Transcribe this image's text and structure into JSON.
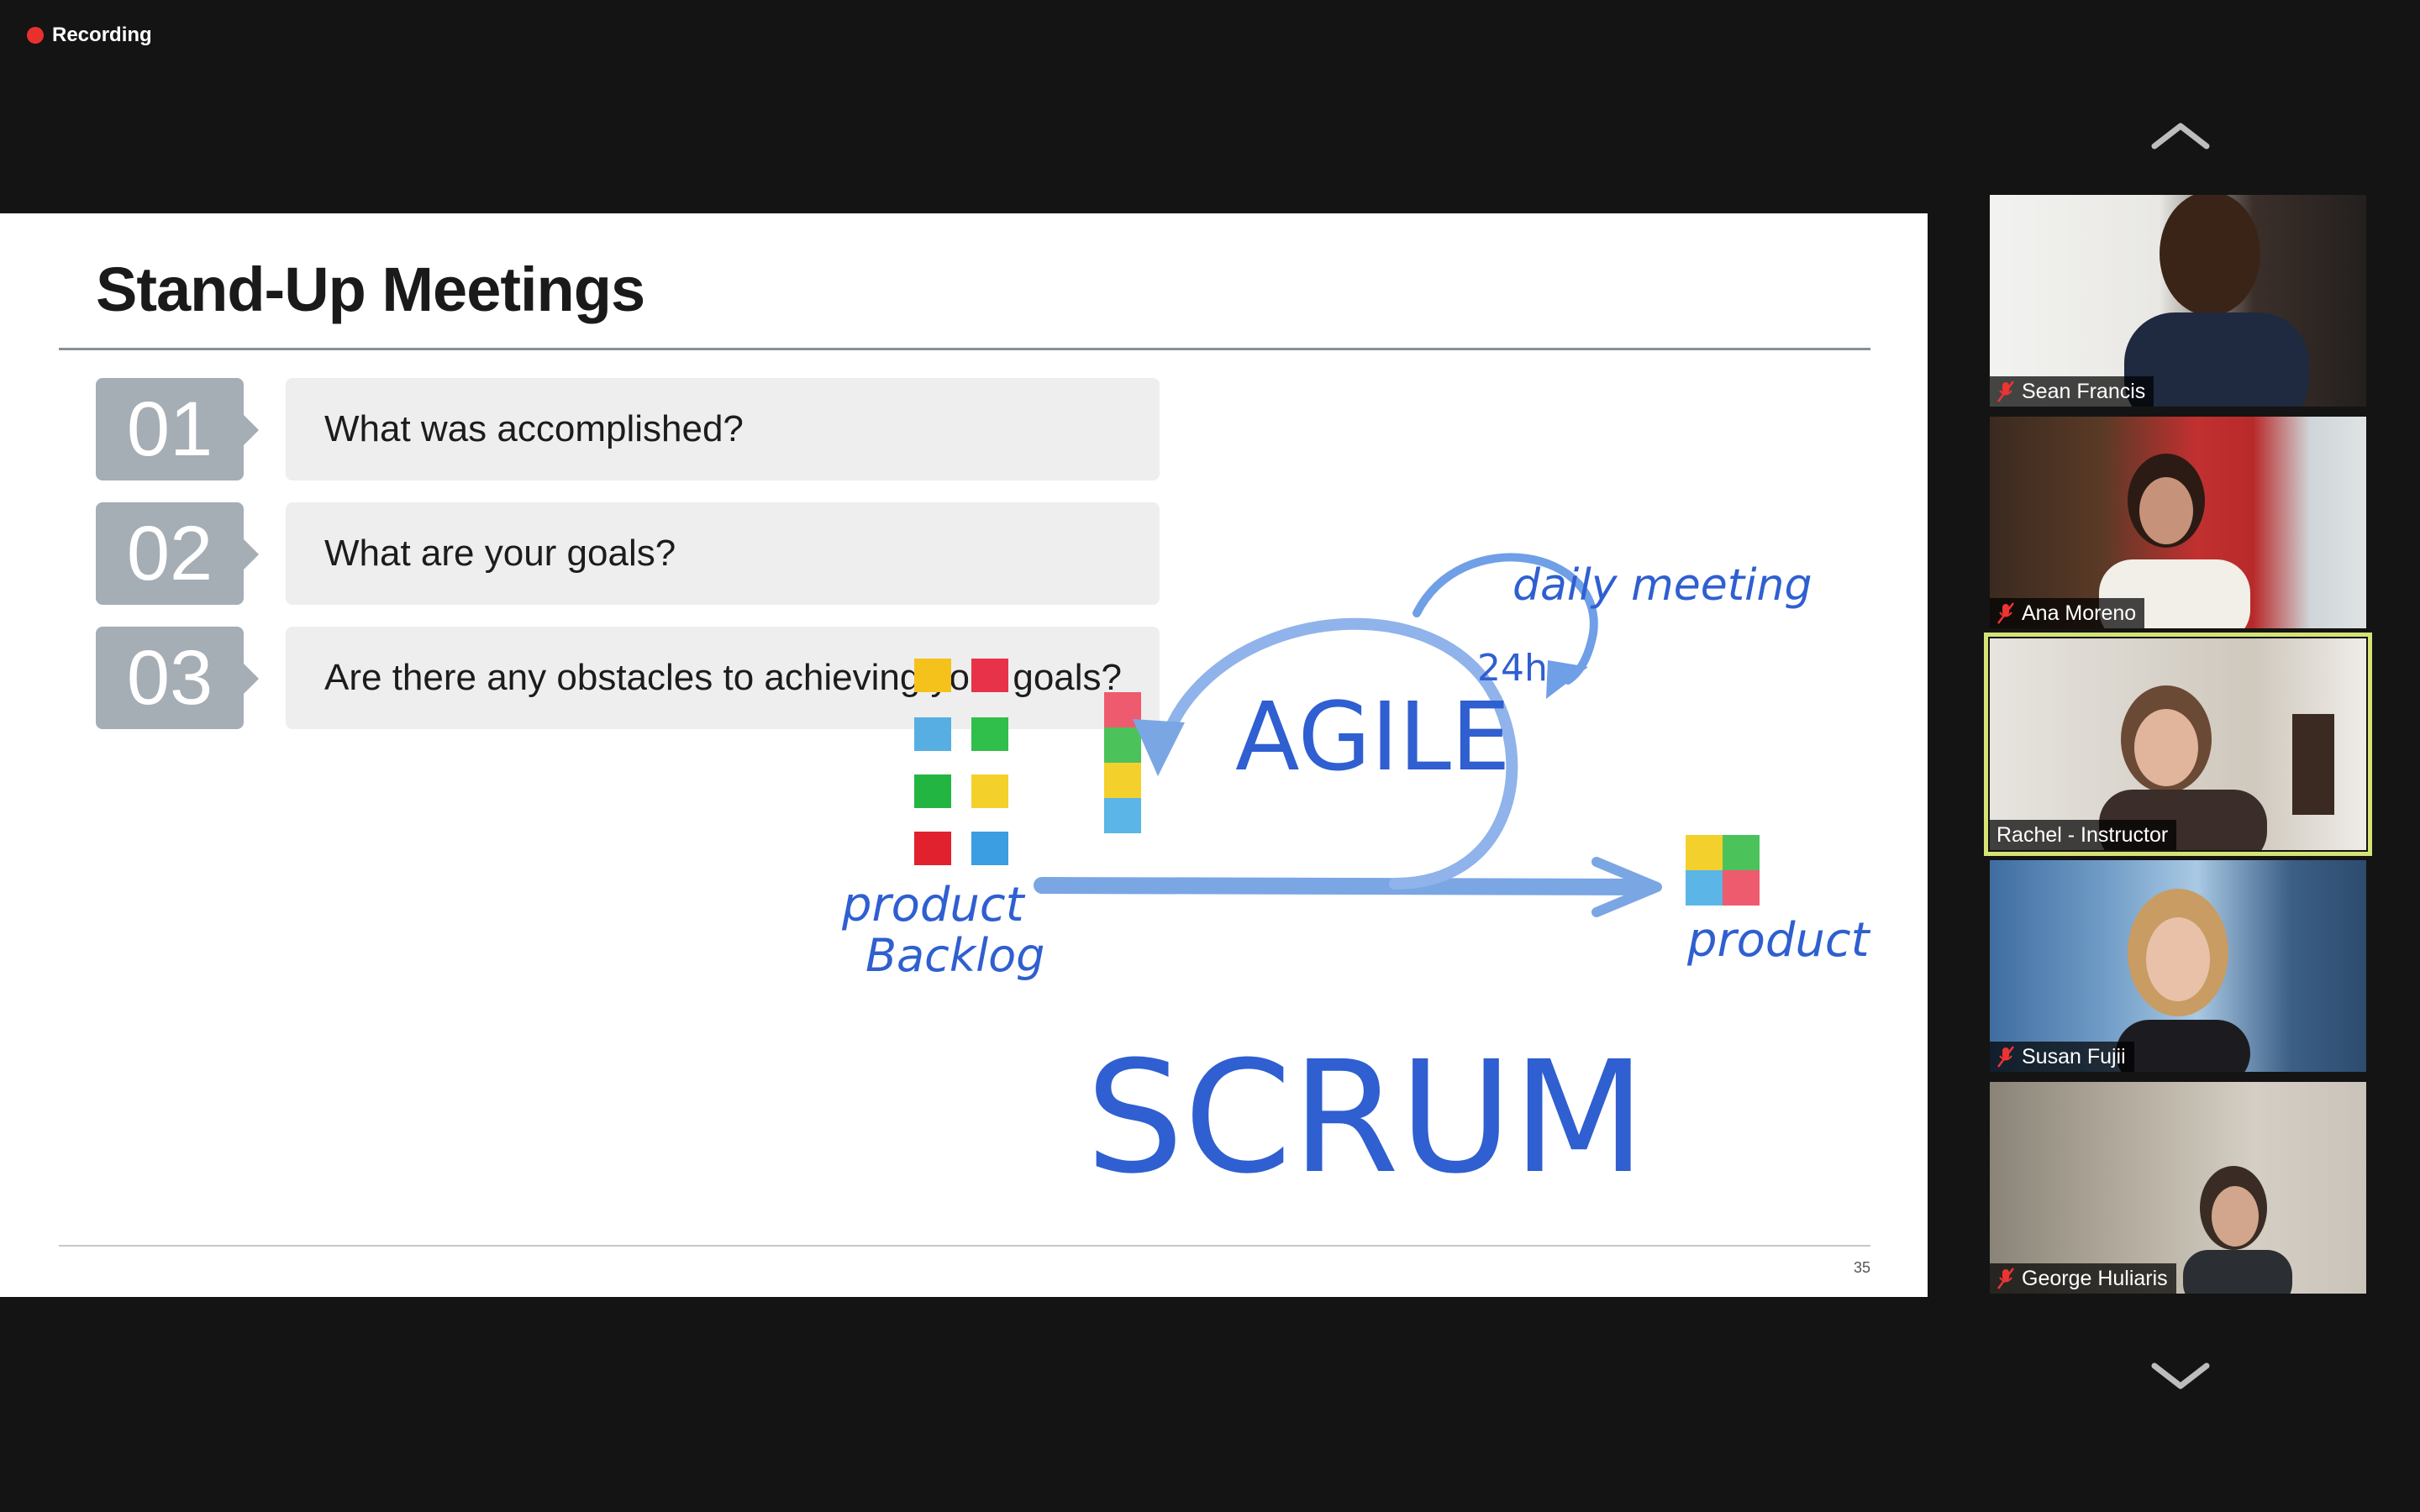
{
  "recording": {
    "label": "Recording",
    "color": "#e8312f"
  },
  "slide": {
    "title": "Stand-Up Meetings",
    "items": [
      {
        "num": "01",
        "text": "What was accomplished?"
      },
      {
        "num": "02",
        "text": "What are your goals?"
      },
      {
        "num": "03",
        "text": "Are there any obstacles to achieving your goals?"
      }
    ],
    "page_number": "35",
    "illustration": {
      "daily_meeting": "daily meeting",
      "cycle": "24h",
      "agile": "AGILE",
      "scrum": "SCRUM",
      "backlog_line1": "product",
      "backlog_line2": "Backlog",
      "product": "product"
    }
  },
  "participants": [
    {
      "name": "Sean Francis",
      "muted": true,
      "active": false
    },
    {
      "name": "Ana Moreno",
      "muted": true,
      "active": false
    },
    {
      "name": "Rachel - Instructor",
      "muted": false,
      "active": true
    },
    {
      "name": "Susan Fujii",
      "muted": true,
      "active": false
    },
    {
      "name": "George Huliaris",
      "muted": true,
      "active": false
    }
  ],
  "colors": {
    "active_border": "#d6e374",
    "ink_blue": "#2f5fd0",
    "badge_gray": "#a5adb5"
  }
}
